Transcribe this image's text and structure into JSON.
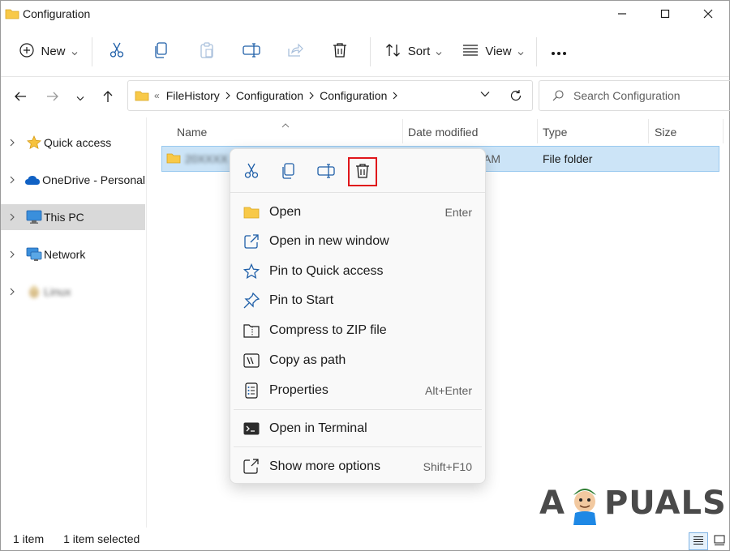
{
  "window": {
    "title": "Configuration"
  },
  "toolbar": {
    "new_label": "New",
    "sort_label": "Sort",
    "view_label": "View"
  },
  "address": {
    "overflow": "«",
    "crumbs": [
      "FileHistory",
      "Configuration",
      "Configuration"
    ]
  },
  "search": {
    "placeholder": "Search Configuration"
  },
  "navpane": {
    "items": [
      {
        "label": "Quick access",
        "icon": "star-icon"
      },
      {
        "label": "OneDrive - Personal",
        "icon": "cloud-icon"
      },
      {
        "label": "This PC",
        "icon": "monitor-icon",
        "selected": true
      },
      {
        "label": "Network",
        "icon": "network-icon"
      },
      {
        "label": "Linux",
        "icon": "penguin-icon"
      }
    ]
  },
  "filelist": {
    "columns": [
      "Name",
      "Date modified",
      "Type",
      "Size"
    ],
    "rows": [
      {
        "name": "20XXXX",
        "date": "AM",
        "type": "File folder",
        "size": ""
      }
    ]
  },
  "context_menu": {
    "quick_actions": [
      "Cut",
      "Copy",
      "Rename",
      "Delete"
    ],
    "items": [
      {
        "label": "Open",
        "shortcut": "Enter",
        "icon": "folder-icon"
      },
      {
        "label": "Open in new window",
        "shortcut": "",
        "icon": "open-new-window-icon"
      },
      {
        "label": "Pin to Quick access",
        "shortcut": "",
        "icon": "star-outline-icon"
      },
      {
        "label": "Pin to Start",
        "shortcut": "",
        "icon": "pin-icon"
      },
      {
        "label": "Compress to ZIP file",
        "shortcut": "",
        "icon": "zip-icon"
      },
      {
        "label": "Copy as path",
        "shortcut": "",
        "icon": "copy-path-icon"
      },
      {
        "label": "Properties",
        "shortcut": "Alt+Enter",
        "icon": "properties-icon"
      },
      {
        "label": "Open in Terminal",
        "shortcut": "",
        "icon": "terminal-icon"
      },
      {
        "label": "Show more options",
        "shortcut": "Shift+F10",
        "icon": "more-options-icon"
      }
    ]
  },
  "status": {
    "count": "1 item",
    "selected": "1 item selected"
  },
  "watermark": {
    "text_left": "A",
    "text_right": "PUALS"
  },
  "colors": {
    "accent": "#0067c0",
    "selection": "#cce4f7",
    "highlight_box": "#e0161b",
    "folder": "#f8c948"
  }
}
